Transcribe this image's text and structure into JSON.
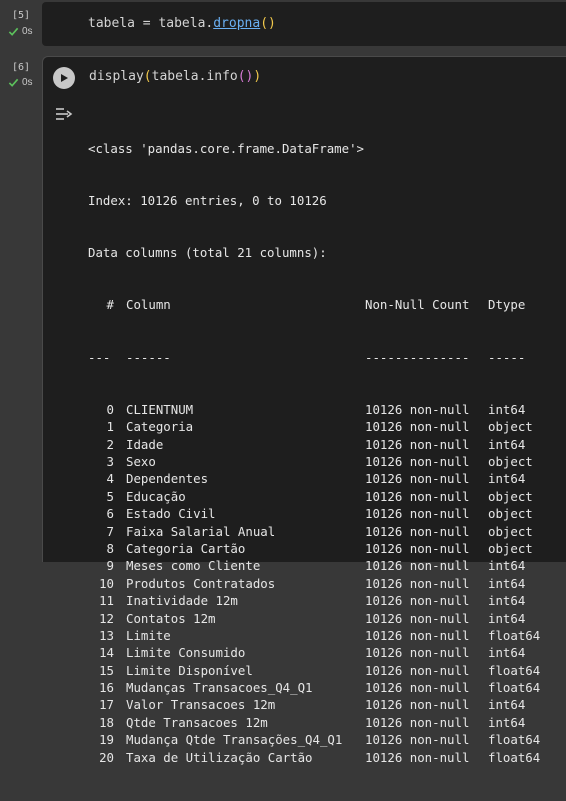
{
  "cell1": {
    "exec_label": "[5]",
    "time": "0s",
    "code_plain_1": "tabela = tabela.",
    "code_attr": "dropna",
    "code_paren": "()"
  },
  "cell2": {
    "exec_label": "[6]",
    "time": "0s",
    "code_fn": "display",
    "code_open": "(",
    "code_mid": "tabela.info",
    "code_inner": "()",
    "code_close": ")"
  },
  "output": {
    "line1": "<class 'pandas.core.frame.DataFrame'>",
    "line2": "Index: 10126 entries, 0 to 10126",
    "line3": "Data columns (total 21 columns):",
    "headers": {
      "num": "#",
      "col": "Column",
      "count": "Non-Null Count",
      "dtype": "Dtype"
    },
    "separators": {
      "num": "---",
      "col": "------",
      "count": "--------------",
      "dtype": "-----"
    },
    "rows": [
      {
        "num": "0",
        "col": "CLIENTNUM",
        "count": "10126 non-null",
        "dtype": "int64"
      },
      {
        "num": "1",
        "col": "Categoria",
        "count": "10126 non-null",
        "dtype": "object"
      },
      {
        "num": "2",
        "col": "Idade",
        "count": "10126 non-null",
        "dtype": "int64"
      },
      {
        "num": "3",
        "col": "Sexo",
        "count": "10126 non-null",
        "dtype": "object"
      },
      {
        "num": "4",
        "col": "Dependentes",
        "count": "10126 non-null",
        "dtype": "int64"
      },
      {
        "num": "5",
        "col": "Educação",
        "count": "10126 non-null",
        "dtype": "object"
      },
      {
        "num": "6",
        "col": "Estado Civil",
        "count": "10126 non-null",
        "dtype": "object"
      },
      {
        "num": "7",
        "col": "Faixa Salarial Anual",
        "count": "10126 non-null",
        "dtype": "object"
      },
      {
        "num": "8",
        "col": "Categoria Cartão",
        "count": "10126 non-null",
        "dtype": "object"
      },
      {
        "num": "9",
        "col": "Meses como Cliente",
        "count": "10126 non-null",
        "dtype": "int64"
      },
      {
        "num": "10",
        "col": "Produtos Contratados",
        "count": "10126 non-null",
        "dtype": "int64"
      },
      {
        "num": "11",
        "col": "Inatividade 12m",
        "count": "10126 non-null",
        "dtype": "int64"
      },
      {
        "num": "12",
        "col": "Contatos 12m",
        "count": "10126 non-null",
        "dtype": "int64"
      },
      {
        "num": "13",
        "col": "Limite",
        "count": "10126 non-null",
        "dtype": "float64"
      },
      {
        "num": "14",
        "col": "Limite Consumido",
        "count": "10126 non-null",
        "dtype": "int64"
      },
      {
        "num": "15",
        "col": "Limite Disponível",
        "count": "10126 non-null",
        "dtype": "float64"
      },
      {
        "num": "16",
        "col": "Mudanças Transacoes_Q4_Q1",
        "count": "10126 non-null",
        "dtype": "float64"
      },
      {
        "num": "17",
        "col": "Valor Transacoes 12m",
        "count": "10126 non-null",
        "dtype": "int64"
      },
      {
        "num": "18",
        "col": "Qtde Transacoes 12m",
        "count": "10126 non-null",
        "dtype": "int64"
      },
      {
        "num": "19",
        "col": "Mudança Qtde Transações_Q4_Q1",
        "count": "10126 non-null",
        "dtype": "float64"
      },
      {
        "num": "20",
        "col": "Taxa de Utilização Cartão",
        "count": "10126 non-null",
        "dtype": "float64"
      }
    ]
  }
}
